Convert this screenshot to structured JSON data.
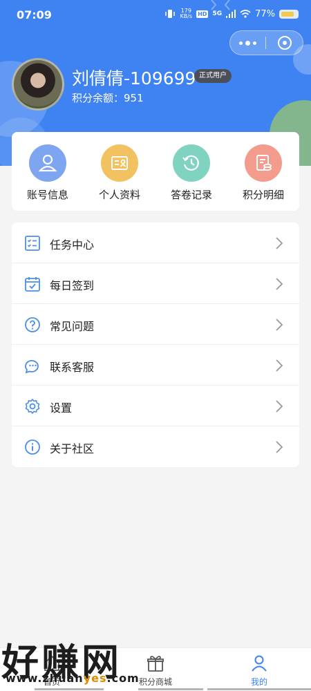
{
  "status_bar": {
    "time": "07:09",
    "net_speed_value": "179",
    "net_speed_unit": "KB/s",
    "signal_label": "5G",
    "hd_label": "HD",
    "battery": "77%"
  },
  "profile": {
    "name": "刘倩倩-109699",
    "badge": "正式用户",
    "points_label": "积分余额：951"
  },
  "quick_actions": [
    {
      "label": "账号信息",
      "icon": "user-icon",
      "color": "#7ea5ef"
    },
    {
      "label": "个人资料",
      "icon": "id-card-icon",
      "color": "#f2c261"
    },
    {
      "label": "答卷记录",
      "icon": "history-icon",
      "color": "#7fd3c0"
    },
    {
      "label": "积分明细",
      "icon": "coins-icon",
      "color": "#f39b8c"
    }
  ],
  "menu": [
    {
      "label": "任务中心",
      "icon": "task-list-icon"
    },
    {
      "label": "每日签到",
      "icon": "calendar-check-icon"
    },
    {
      "label": "常见问题",
      "icon": "question-icon"
    },
    {
      "label": "联系客服",
      "icon": "chat-icon"
    },
    {
      "label": "设置",
      "icon": "gear-icon"
    },
    {
      "label": "关于社区",
      "icon": "info-icon"
    }
  ],
  "tabs": [
    {
      "label": "首页",
      "icon": "home-icon",
      "active": false
    },
    {
      "label": "积分商城",
      "icon": "gift-icon",
      "active": false
    },
    {
      "label": "我的",
      "icon": "person-icon",
      "active": true
    }
  ],
  "watermark": {
    "big": "好赚网",
    "small_prefix": "www.zhuan",
    "small_accent": "yes",
    "small_suffix": ".com"
  },
  "colors": {
    "brand_blue": "#3f83f2",
    "icon_blue": "#4a8ee8"
  }
}
